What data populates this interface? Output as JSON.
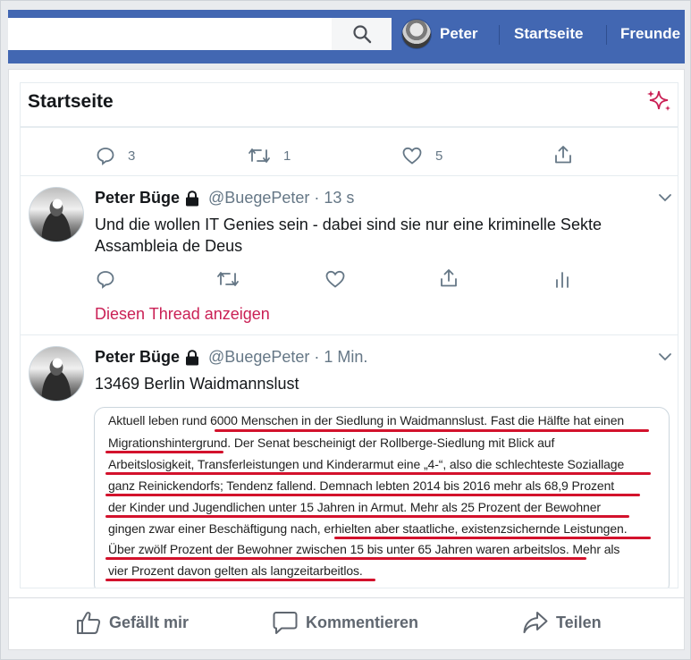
{
  "colors": {
    "fb_blue": "#4267b2",
    "twitter_pink": "#ca2055",
    "underline_red": "#d3122c",
    "gray_text": "#657786"
  },
  "topbar": {
    "search_placeholder": "",
    "search_icon": "search-icon",
    "profile_name": "Peter",
    "links": [
      "Startseite",
      "Freunde"
    ]
  },
  "twitter": {
    "header_title": "Startseite",
    "header_icon": "sparkle-icon",
    "top_actions": {
      "replies": "3",
      "retweets": "1",
      "likes": "5"
    },
    "tweets": [
      {
        "name": "Peter Büge",
        "handle": "@BuegePeter",
        "time": "· 13 s",
        "lines": [
          "Und die wollen IT Genies sein - dabei sind sie nur eine kriminelle Sekte",
          "Assambleia de Deus"
        ],
        "thread_link": "Diesen Thread anzeigen"
      },
      {
        "name": "Peter Büge",
        "handle": "@BuegePeter",
        "time": "· 1 Min.",
        "lines": [
          "13469 Berlin Waidmannslust"
        ]
      }
    ],
    "document_lines": [
      "Aktuell leben rund 6000 Menschen in der Siedlung in Waidmannslust. Fast die Hälfte hat einen",
      "Migrationshintergrund. Der Senat bescheinigt der Rollberge-Siedlung mit Blick auf",
      "Arbeitslosigkeit, Transferleistungen und Kinderarmut eine „4-“, also die schlechteste Soziallage",
      "ganz Reinickendorfs; Tendenz fallend. Demnach lebten 2014 bis 2016 mehr als 68,9 Prozent",
      "der Kinder und Jugendlichen unter 15 Jahren in Armut. Mehr als 25 Prozent der Bewohner",
      "gingen zwar einer Beschäftigung nach, erhielten aber staatliche, existenzsichernde Leistungen.",
      "Über zwölf Prozent der Bewohner zwischen 15 bis unter 65 Jahren waren arbeitslos. Mehr als",
      "vier Prozent davon gelten als langzeitarbeitlos."
    ]
  },
  "footer": {
    "like": "Gefällt mir",
    "comment": "Kommentieren",
    "share": "Teilen"
  }
}
